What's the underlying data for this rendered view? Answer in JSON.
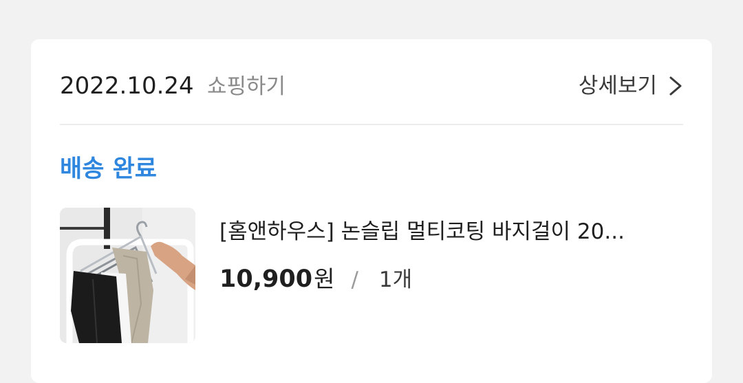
{
  "order": {
    "date": "2022.10.24",
    "category": "쇼핑하기",
    "detail_label": "상세보기",
    "status": "배송 완료",
    "status_color": "#2e86de"
  },
  "item": {
    "image_icon": "product-photo-pants-hanger",
    "name": "[홈앤하우스] 논슬립 멀티코팅 바지걸이 20...",
    "price": "10,900",
    "price_unit": "원",
    "separator": "/",
    "quantity": "1개"
  }
}
